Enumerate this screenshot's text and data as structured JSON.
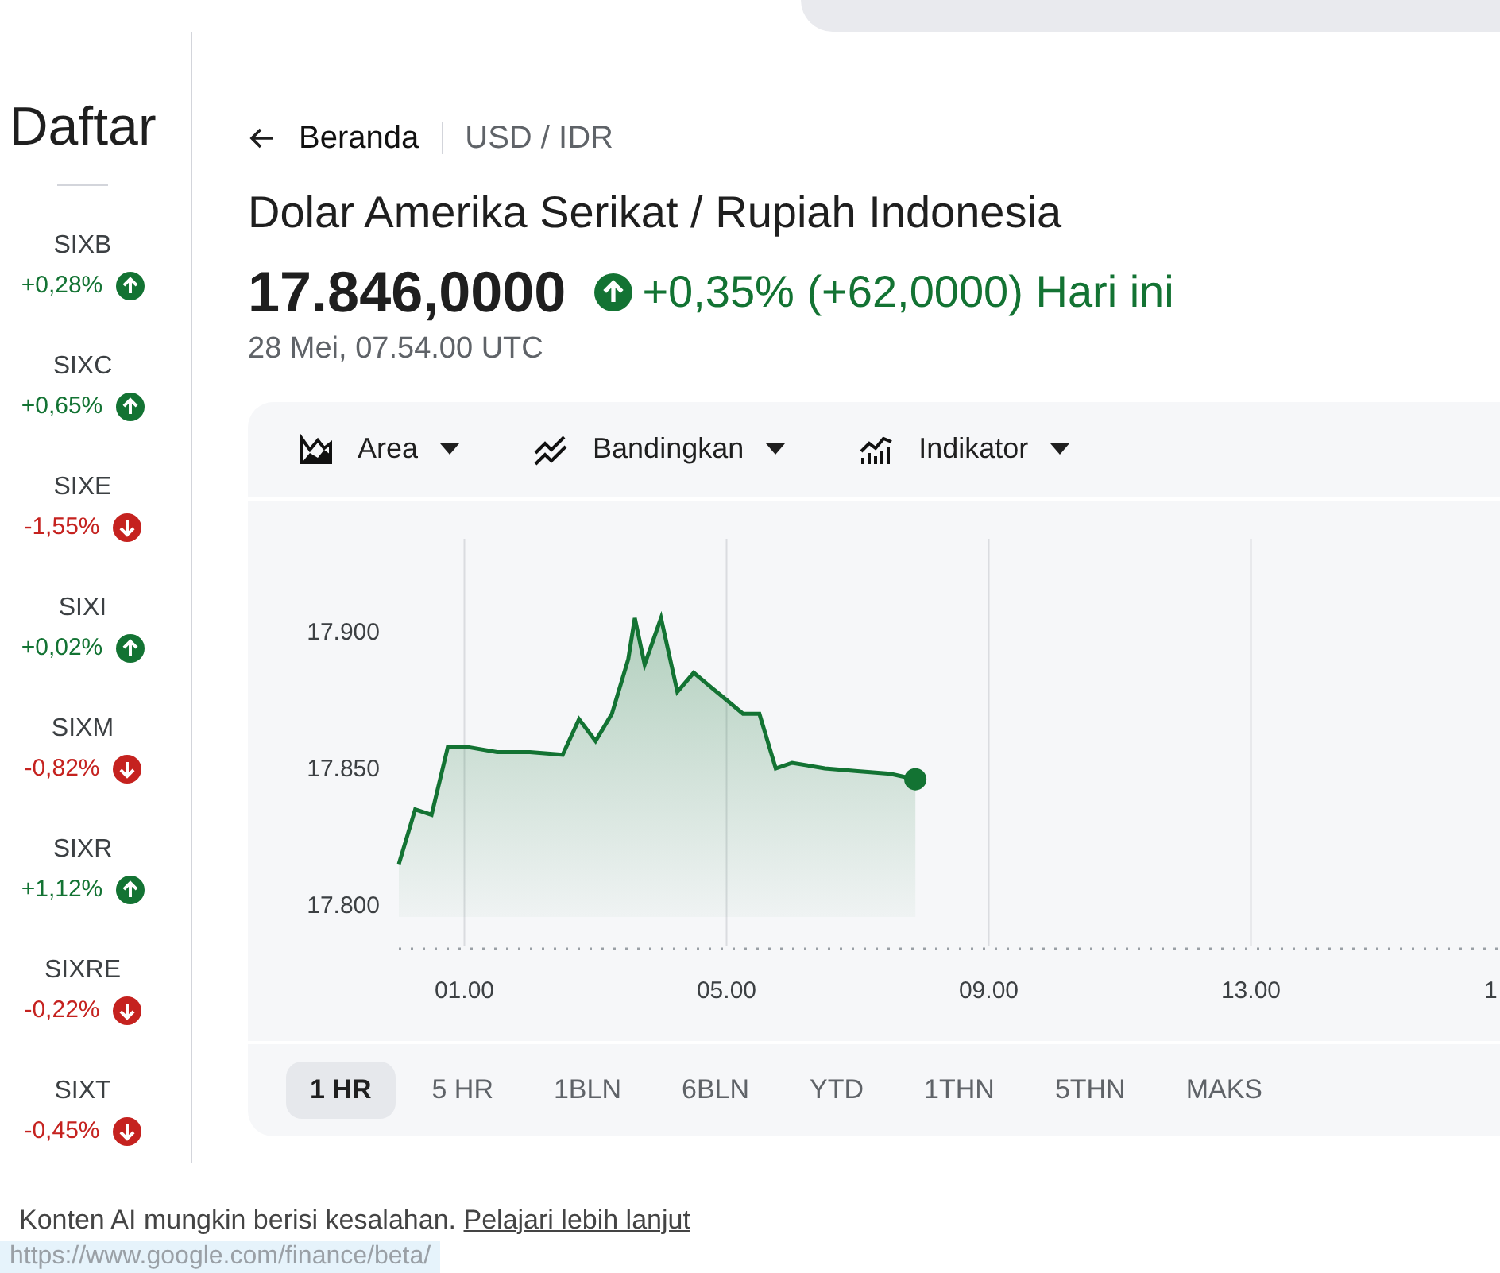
{
  "sidebar": {
    "title": "Daftar",
    "items": [
      {
        "symbol": "SIXB",
        "change": "+0,28%",
        "kind": "up"
      },
      {
        "symbol": "SIXC",
        "change": "+0,65%",
        "kind": "up"
      },
      {
        "symbol": "SIXE",
        "change": "-1,55%",
        "kind": "down"
      },
      {
        "symbol": "SIXI",
        "change": "+0,02%",
        "kind": "up"
      },
      {
        "symbol": "SIXM",
        "change": "-0,82%",
        "kind": "down"
      },
      {
        "symbol": "SIXR",
        "change": "+1,12%",
        "kind": "up"
      },
      {
        "symbol": "SIXRE",
        "change": "-0,22%",
        "kind": "down"
      },
      {
        "symbol": "SIXT",
        "change": "-0,45%",
        "kind": "down"
      }
    ]
  },
  "breadcrumb": {
    "back": "Beranda",
    "current": "USD / IDR"
  },
  "title": "Dolar Amerika Serikat / Rupiah Indonesia",
  "quote": {
    "price": "17.846,0000",
    "kind": "up",
    "change": "+0,35% (+62,0000) Hari ini",
    "timestamp": "28 Mei, 07.54.00 UTC"
  },
  "toolbar": [
    {
      "kind": "area",
      "label": "Area"
    },
    {
      "kind": "compare",
      "label": "Bandingkan"
    },
    {
      "kind": "indicator",
      "label": "Indikator"
    }
  ],
  "chart_data": {
    "type": "area",
    "x": [
      0,
      0.25,
      0.5,
      0.75,
      1,
      1.5,
      2,
      2.5,
      2.75,
      3,
      3.25,
      3.5,
      3.6,
      3.75,
      4,
      4.25,
      4.5,
      4.75,
      5,
      5.25,
      5.5,
      5.75,
      6,
      6.5,
      7,
      7.5,
      7.88
    ],
    "series": [
      {
        "color": "#137333",
        "values": [
          17815,
          17835,
          17833,
          17858,
          17858,
          17856,
          17856,
          17855,
          17868,
          17860,
          17870,
          17890,
          17905,
          17888,
          17905,
          17878,
          17885,
          17880,
          17875,
          17870,
          17870,
          17850,
          17852,
          17850,
          17849,
          17848,
          17846
        ]
      }
    ],
    "grid": true,
    "xlim": [
      0,
      16.8
    ],
    "ylim": [
      17784,
      17934
    ],
    "yticks": [
      {
        "value": 17800,
        "label": "17.800"
      },
      {
        "value": 17850,
        "label": "17.850"
      },
      {
        "value": 17900,
        "label": "17.900"
      }
    ],
    "xticks": [
      {
        "value": 1,
        "label": "01.00"
      },
      {
        "value": 5,
        "label": "05.00"
      },
      {
        "value": 9,
        "label": "09.00"
      },
      {
        "value": 13,
        "label": "13.00"
      }
    ]
  },
  "chart_edge_label": "1",
  "ranges": [
    {
      "label": "1 HR",
      "selected": true
    },
    {
      "label": "5 HR",
      "selected": false
    },
    {
      "label": "1BLN",
      "selected": false
    },
    {
      "label": "6BLN",
      "selected": false
    },
    {
      "label": "YTD",
      "selected": false
    },
    {
      "label": "1THN",
      "selected": false
    },
    {
      "label": "5THN",
      "selected": false
    },
    {
      "label": "MAKS",
      "selected": false
    }
  ],
  "footer": {
    "text": "Konten AI mungkin berisi kesalahan.",
    "link": "Pelajari lebih lanjut"
  },
  "status_url": "https://www.google.com/finance/beta/"
}
